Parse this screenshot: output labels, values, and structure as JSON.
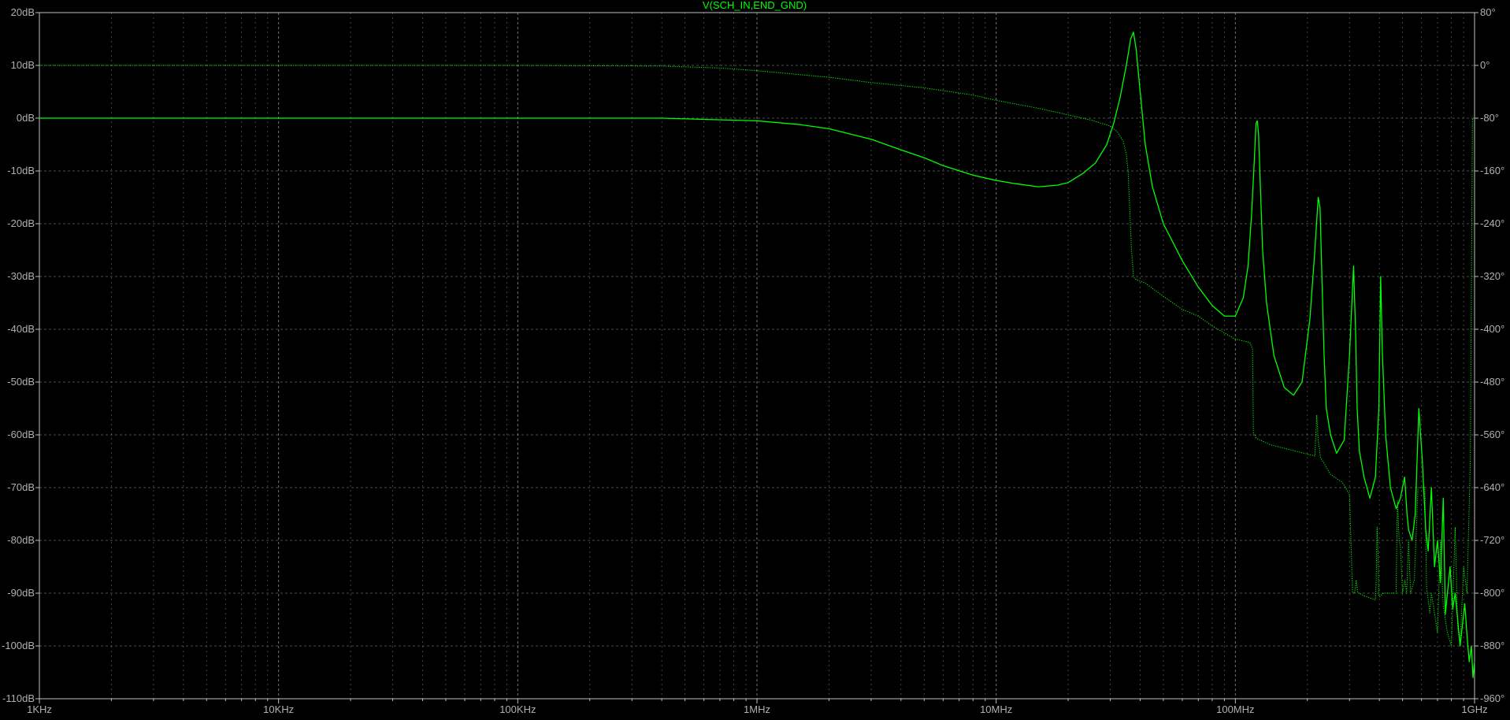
{
  "chart_data": {
    "type": "line",
    "title": "V(SCH_IN,END_GND)",
    "x_scale": "log",
    "x_unit": "Hz",
    "xlim": [
      1000,
      1000000000
    ],
    "x_tick_labels": [
      "1KHz",
      "10KHz",
      "100KHz",
      "1MHz",
      "10MHz",
      "100MHz",
      "1GHz"
    ],
    "ylim_left": [
      -110,
      20
    ],
    "ylim_right": [
      -960,
      80
    ],
    "y_left_tick_labels": [
      "20dB",
      "10dB",
      "0dB",
      "-10dB",
      "-20dB",
      "-30dB",
      "-40dB",
      "-50dB",
      "-60dB",
      "-70dB",
      "-80dB",
      "-90dB",
      "-100dB",
      "-110dB"
    ],
    "y_right_tick_labels": [
      "80°",
      "0°",
      "-80°",
      "-160°",
      "-240°",
      "-320°",
      "-400°",
      "-480°",
      "-560°",
      "-640°",
      "-720°",
      "-800°",
      "-880°",
      "-960°"
    ],
    "grid": true,
    "colors": {
      "background": "#000000",
      "trace": "#00ff00",
      "grid": "#808080",
      "axis": "#c0c0c0",
      "labels": "#b0b0b0"
    },
    "series": [
      {
        "axis": "left",
        "style": "solid",
        "x": [
          1000,
          10000,
          100000,
          400000,
          1000000,
          1500000,
          2000000,
          3000000,
          4000000,
          5000000,
          6000000,
          8000000,
          10000000,
          12000000,
          15000000,
          18000000,
          20000000,
          23000000,
          26000000,
          29000000,
          31000000,
          33000000,
          35000000,
          36500000,
          37500000,
          38500000,
          40000000,
          42000000,
          45000000,
          50000000,
          60000000,
          70000000,
          80000000,
          90000000,
          100000000,
          108000000,
          113000000,
          117000000,
          120000000,
          122000000,
          123500000,
          125000000,
          127000000,
          130000000,
          135000000,
          145000000,
          160000000,
          175000000,
          190000000,
          205000000,
          215000000,
          222000000,
          226000000,
          230000000,
          235000000,
          240000000,
          250000000,
          265000000,
          285000000,
          300000000,
          312000000,
          318000000,
          323000000,
          330000000,
          345000000,
          365000000,
          385000000,
          398000000,
          405000000,
          412000000,
          425000000,
          445000000,
          470000000,
          490000000,
          510000000,
          522000000,
          530000000,
          548000000,
          565000000,
          585000000,
          605000000,
          625000000,
          640000000,
          660000000,
          680000000,
          700000000,
          720000000,
          740000000,
          755000000,
          770000000,
          790000000,
          810000000,
          830000000,
          850000000,
          870000000,
          890000000,
          910000000,
          930000000,
          950000000,
          970000000,
          985000000,
          1000000000
        ],
        "y": [
          0,
          0,
          0,
          0,
          -0.5,
          -1.2,
          -2,
          -4,
          -6,
          -7.5,
          -9,
          -10.8,
          -11.8,
          -12.4,
          -13,
          -12.7,
          -12.2,
          -10.5,
          -8.5,
          -5,
          -1,
          4,
          10,
          15,
          16.3,
          13,
          5,
          -5,
          -13,
          -20,
          -27,
          -32,
          -35.5,
          -37.5,
          -37.5,
          -34,
          -28,
          -18,
          -8,
          -1,
          -0.5,
          -3,
          -12,
          -25,
          -35,
          -45,
          -51,
          -52.5,
          -50,
          -38,
          -25,
          -15,
          -17,
          -30,
          -45,
          -55,
          -60,
          -63.5,
          -61,
          -45,
          -28,
          -40,
          -55,
          -63,
          -68,
          -72,
          -68,
          -55,
          -30,
          -45,
          -60,
          -70,
          -74,
          -72,
          -68,
          -75,
          -78,
          -80,
          -75,
          -55,
          -65,
          -78,
          -82,
          -70,
          -85,
          -80,
          -88,
          -72,
          -94,
          -90,
          -85,
          -93,
          -90,
          -95,
          -100,
          -96,
          -92,
          -98,
          -103,
          -100,
          -106,
          -103
        ]
      },
      {
        "axis": "right",
        "style": "dotted",
        "x": [
          1000,
          10000,
          100000,
          400000,
          700000,
          1000000,
          2000000,
          3000000,
          5000000,
          8000000,
          10000000,
          15000000,
          20000000,
          25000000,
          30000000,
          32000000,
          34000000,
          35000000,
          35600000,
          36000000,
          36800000,
          37500000,
          38500000,
          42000000,
          50000000,
          60000000,
          70000000,
          80000000,
          100000000,
          115000000,
          118000000,
          119000000,
          120000000,
          121000000,
          122000000,
          140000000,
          180000000,
          215000000,
          219000000,
          221000000,
          223000000,
          225000000,
          226000000,
          227000000,
          232000000,
          250000000,
          280000000,
          300000000,
          309000000,
          315000000,
          320000000,
          325000000,
          330000000,
          350000000,
          385000000,
          388000000,
          391000000,
          395000000,
          398000000,
          402000000,
          415000000,
          435000000,
          470000000,
          473000000,
          476000000,
          480000000,
          484000000,
          490000000,
          500000000,
          512000000,
          520000000,
          530000000,
          540000000,
          560000000,
          580000000,
          620000000,
          630000000,
          640000000,
          650000000,
          660000000,
          680000000,
          700000000,
          720000000,
          740000000,
          770000000,
          800000000,
          830000000,
          850000000,
          870000000,
          900000000,
          930000000,
          960000000,
          980000000,
          1000000000
        ],
        "y": [
          0,
          0,
          0,
          -1,
          -4,
          -8,
          -18,
          -26,
          -34,
          -45,
          -53,
          -65,
          -75,
          -83,
          -92,
          -100,
          -115,
          -135,
          -160,
          -200,
          -280,
          -320,
          -325,
          -330,
          -350,
          -370,
          -380,
          -395,
          -415,
          -420,
          -430,
          -560,
          -560,
          -560,
          -565,
          -575,
          -585,
          -592,
          -530,
          -555,
          -575,
          -580,
          -590,
          -595,
          -600,
          -620,
          -632,
          -650,
          -800,
          -800,
          -780,
          -800,
          -800,
          -805,
          -810,
          -780,
          -700,
          -740,
          -805,
          -805,
          -800,
          -800,
          -800,
          -720,
          -660,
          -690,
          -720,
          -730,
          -800,
          -780,
          -800,
          -720,
          -800,
          -780,
          -640,
          -640,
          -790,
          -810,
          -830,
          -800,
          -830,
          -860,
          -720,
          -820,
          -860,
          -880,
          -700,
          -850,
          -880,
          -760,
          -800,
          -600,
          -80,
          -80
        ]
      }
    ]
  }
}
